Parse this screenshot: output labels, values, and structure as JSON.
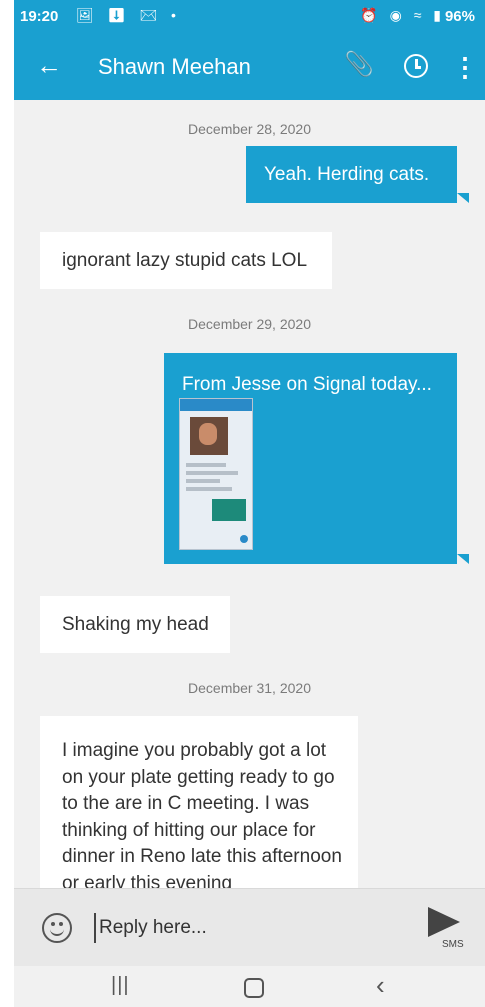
{
  "status_bar": {
    "time": "19:20",
    "left_icons": "🖼 ⬇ ✉ •",
    "right_icons": "⏰ ◉ ≈ ▮",
    "battery": "96%"
  },
  "header": {
    "back_icon": "←",
    "title": "Shawn Meehan",
    "attach_icon": "📎",
    "menu_icon": "⋮"
  },
  "messages": [
    {
      "type": "date",
      "text": "December 28, 2020"
    },
    {
      "type": "outgoing",
      "text": "Yeah. Herding cats."
    },
    {
      "type": "incoming",
      "text": "ignorant lazy stupid cats LOL"
    },
    {
      "type": "date",
      "text": "December 29, 2020"
    },
    {
      "type": "outgoing",
      "text": "From Jesse on Signal today..."
    },
    {
      "type": "incoming",
      "text": "Shaking my head"
    },
    {
      "type": "date",
      "text": "December 31, 2020"
    },
    {
      "type": "incoming",
      "text": "I imagine you probably got a lot on your plate getting ready to go to the are in C meeting. I was thinking of hitting our place for dinner in Reno late this afternoon or early this evening"
    }
  ],
  "composer": {
    "placeholder": "Reply here...",
    "send_label": "SMS"
  },
  "nav": {
    "recents_icon": "|||",
    "back_icon": "‹"
  },
  "colors": {
    "accent": "#1aa0d0",
    "incoming_bubble": "#ffffff",
    "background": "#f1f1f1"
  }
}
